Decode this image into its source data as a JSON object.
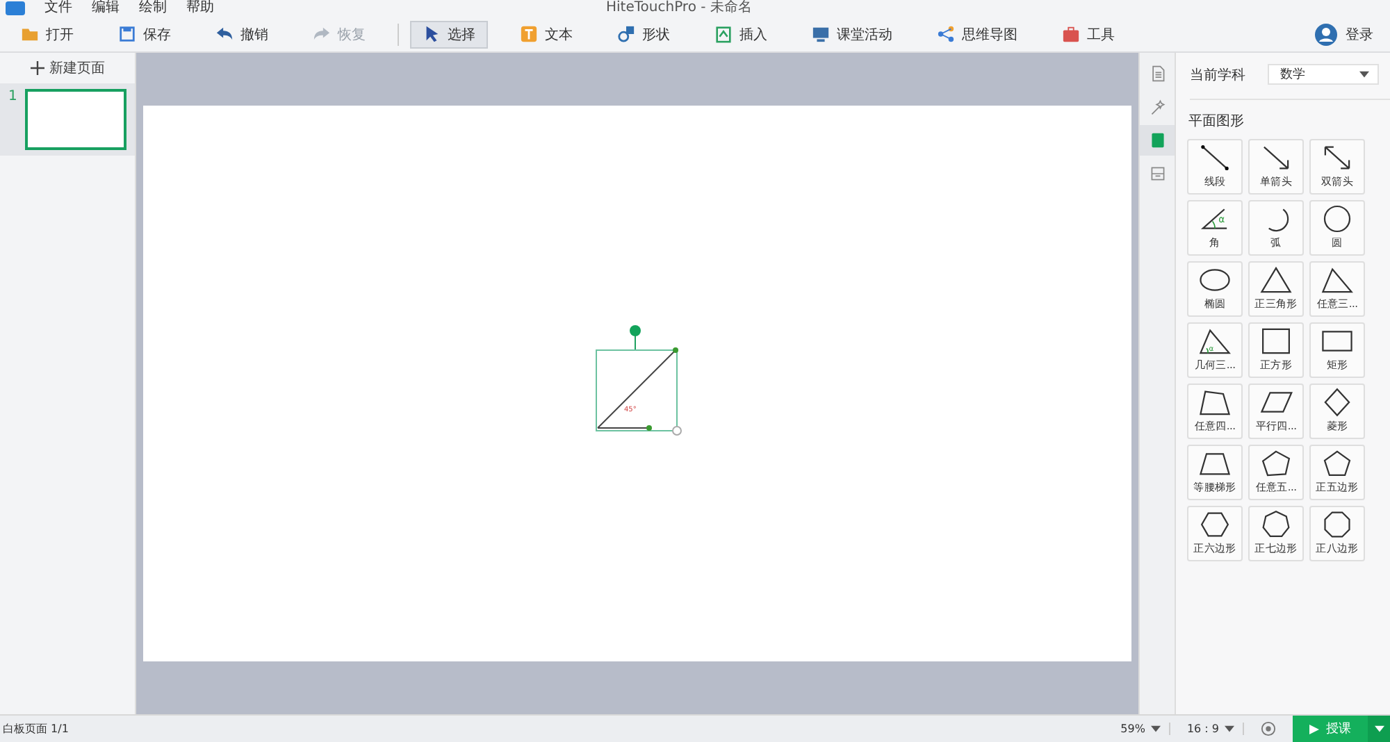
{
  "menu": [
    "文件",
    "编辑",
    "绘制",
    "帮助"
  ],
  "window": {
    "title": "HiteTouchPro - 未命名"
  },
  "toolbar": [
    {
      "label": "打开",
      "kind": "open",
      "selected": false,
      "disabled": false
    },
    {
      "label": "保存",
      "kind": "save",
      "selected": false,
      "disabled": false
    },
    {
      "label": "撤销",
      "kind": "undo",
      "selected": false,
      "disabled": false
    },
    {
      "label": "恢复",
      "kind": "redo",
      "selected": false,
      "disabled": true
    },
    {
      "label": "选择",
      "kind": "select",
      "selected": true,
      "disabled": false
    },
    {
      "label": "文本",
      "kind": "text",
      "selected": false,
      "disabled": false
    },
    {
      "label": "形状",
      "kind": "shape",
      "selected": false,
      "disabled": false
    },
    {
      "label": "插入",
      "kind": "insert",
      "selected": false,
      "disabled": false
    },
    {
      "label": "课堂活动",
      "kind": "activity",
      "selected": false,
      "disabled": false
    },
    {
      "label": "思维导图",
      "kind": "mindmap",
      "selected": false,
      "disabled": false
    },
    {
      "label": "工具",
      "kind": "tools",
      "selected": false,
      "disabled": false
    }
  ],
  "login": {
    "label": "登录"
  },
  "pages_panel": {
    "new_page": "新建页面",
    "pages": [
      {
        "number": "1",
        "selected": true
      }
    ]
  },
  "canvas": {
    "angle_label": "45°"
  },
  "side_tabs": [
    {
      "kind": "document",
      "selected": false
    },
    {
      "kind": "magic",
      "selected": false
    },
    {
      "kind": "book",
      "selected": true
    },
    {
      "kind": "archive",
      "selected": false
    }
  ],
  "subject": {
    "label": "当前学科",
    "value": "数学"
  },
  "section_title": "平面图形",
  "shapes": [
    {
      "label": "线段",
      "kind": "segment"
    },
    {
      "label": "单箭头",
      "kind": "arrow"
    },
    {
      "label": "双箭头",
      "kind": "double-arrow"
    },
    {
      "label": "角",
      "kind": "angle",
      "symbol": "α"
    },
    {
      "label": "弧",
      "kind": "arc"
    },
    {
      "label": "圆",
      "kind": "circle"
    },
    {
      "label": "椭圆",
      "kind": "ellipse"
    },
    {
      "label": "正三角形",
      "kind": "triangle"
    },
    {
      "label": "任意三...",
      "kind": "any-triangle"
    },
    {
      "label": "几何三...",
      "kind": "geo-triangle",
      "symbol": "α"
    },
    {
      "label": "正方形",
      "kind": "square"
    },
    {
      "label": "矩形",
      "kind": "rectangle"
    },
    {
      "label": "任意四...",
      "kind": "quad"
    },
    {
      "label": "平行四...",
      "kind": "parallelogram"
    },
    {
      "label": "菱形",
      "kind": "rhombus"
    },
    {
      "label": "等腰梯形",
      "kind": "trapezoid"
    },
    {
      "label": "任意五...",
      "kind": "any-pentagon"
    },
    {
      "label": "正五边形",
      "kind": "pentagon"
    },
    {
      "label": "正六边形",
      "kind": "hexagon"
    },
    {
      "label": "正七边形",
      "kind": "heptagon"
    },
    {
      "label": "正八边形",
      "kind": "octagon"
    }
  ],
  "status_bar": {
    "page": "白板页面 1/1",
    "zoom": "59%",
    "ratio": "16 : 9",
    "teach": "授课"
  }
}
